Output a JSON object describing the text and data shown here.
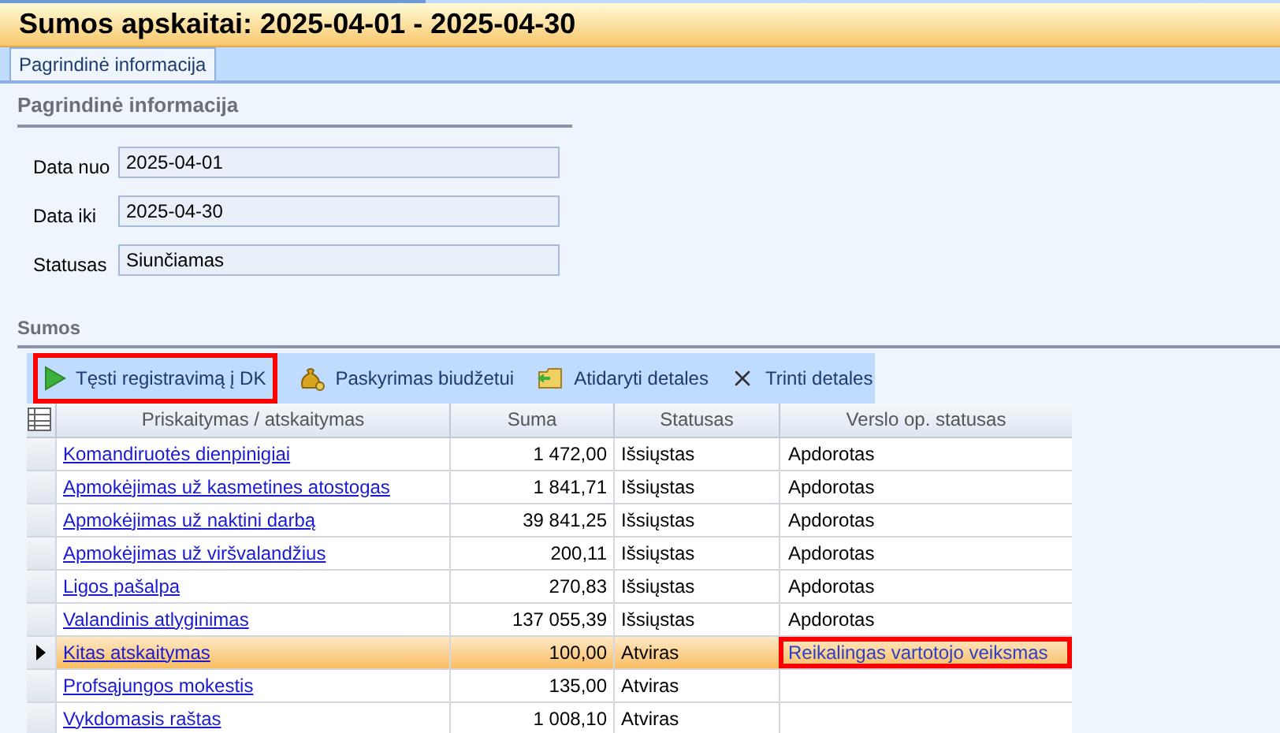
{
  "window": {
    "title": "Sumos apskaitai: 2025-04-01 - 2025-04-30"
  },
  "tabs": [
    {
      "label": "Pagrindinė informacija",
      "selected": true
    }
  ],
  "info": {
    "heading": "Pagrindinė informacija",
    "fields": [
      {
        "label": "Data nuo",
        "value": "2025-04-01"
      },
      {
        "label": "Data iki",
        "value": "2025-04-30"
      },
      {
        "label": "Statusas",
        "value": "Siunčiamas"
      }
    ]
  },
  "sums": {
    "heading": "Sumos",
    "toolbar": [
      {
        "kind": "play",
        "label": "Tęsti registravimą į DK",
        "highlighted": true
      },
      {
        "kind": "money",
        "label": "Paskyrimas biudžetui",
        "highlighted": false
      },
      {
        "kind": "open",
        "label": "Atidaryti detales",
        "highlighted": false
      },
      {
        "kind": "delete",
        "label": "Trinti detales",
        "highlighted": false
      }
    ],
    "table": {
      "columns": [
        "Priskaitymas / atskaitymas",
        "Suma",
        "Statusas",
        "Verslo op. statusas"
      ],
      "rows": [
        {
          "name": "Komandiruotės dienpinigiai",
          "amount": "1 472,00",
          "status": "Išsiųstas",
          "op_status": "Apdorotas",
          "selected": false,
          "highlighted": false
        },
        {
          "name": "Apmokėjimas už kasmetines atostogas",
          "amount": "1 841,71",
          "status": "Išsiųstas",
          "op_status": "Apdorotas",
          "selected": false,
          "highlighted": false
        },
        {
          "name": "Apmokėjimas už naktini darbą",
          "amount": "39 841,25",
          "status": "Išsiųstas",
          "op_status": "Apdorotas",
          "selected": false,
          "highlighted": false
        },
        {
          "name": "Apmokėjimas už viršvalandžius",
          "amount": "200,11",
          "status": "Išsiųstas",
          "op_status": "Apdorotas",
          "selected": false,
          "highlighted": false
        },
        {
          "name": "Ligos pašalpa",
          "amount": "270,83",
          "status": "Išsiųstas",
          "op_status": "Apdorotas",
          "selected": false,
          "highlighted": false
        },
        {
          "name": "Valandinis atlyginimas",
          "amount": "137 055,39",
          "status": "Išsiųstas",
          "op_status": "Apdorotas",
          "selected": false,
          "highlighted": false
        },
        {
          "name": "Kitas atskaitymas",
          "amount": "100,00",
          "status": "Atviras",
          "op_status": "Reikalingas vartotojo veiksmas",
          "selected": true,
          "highlighted": true
        },
        {
          "name": "Profsąjungos mokestis",
          "amount": "135,00",
          "status": "Atviras",
          "selected": false,
          "highlighted": false
        },
        {
          "name": "Vykdomasis raštas",
          "amount": "1 008,10",
          "status": "Atviras",
          "selected": false,
          "highlighted": false
        }
      ]
    }
  }
}
